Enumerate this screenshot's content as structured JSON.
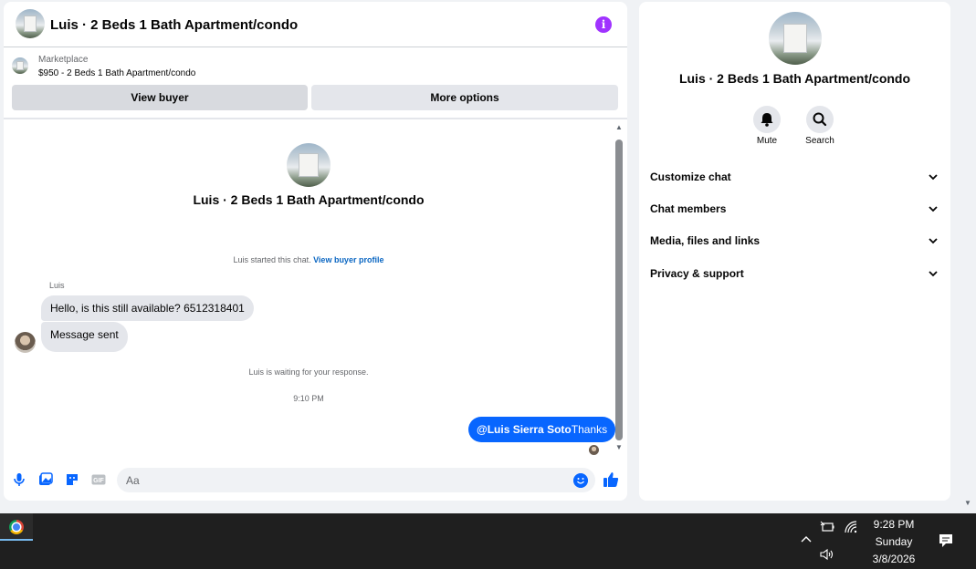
{
  "chat": {
    "title": "Luis · 2 Beds 1 Bath Apartment/condo",
    "listing_kicker": "Marketplace",
    "listing_line": "$950 - 2 Beds 1 Bath Apartment/condo",
    "view_buyer_label": "View buyer",
    "more_options_label": "More options",
    "conv_title": "Luis · 2 Beds 1 Bath Apartment/condo",
    "started_text": "Luis started this chat.",
    "started_link": "View buyer profile",
    "sender_name": "Luis",
    "messages_in": [
      "Hello, is this still available? 6512318401",
      "Message sent"
    ],
    "waiting_text": "Luis is waiting for your response.",
    "time_text": "9:10 PM",
    "out_mention": "@Luis Sierra Soto",
    "out_text": "Thanks",
    "composer_placeholder": "Aa"
  },
  "info": {
    "title": "Luis · 2 Beds 1 Bath Apartment/condo",
    "mute_label": "Mute",
    "search_label": "Search",
    "menu": [
      "Customize chat",
      "Chat members",
      "Media, files and links",
      "Privacy & support"
    ]
  },
  "taskbar": {
    "time": "9:28 PM",
    "day": "Sunday",
    "date": "3/8/2026"
  },
  "colors": {
    "accent_blue": "#0866ff",
    "info_purple": "#a033ff"
  }
}
